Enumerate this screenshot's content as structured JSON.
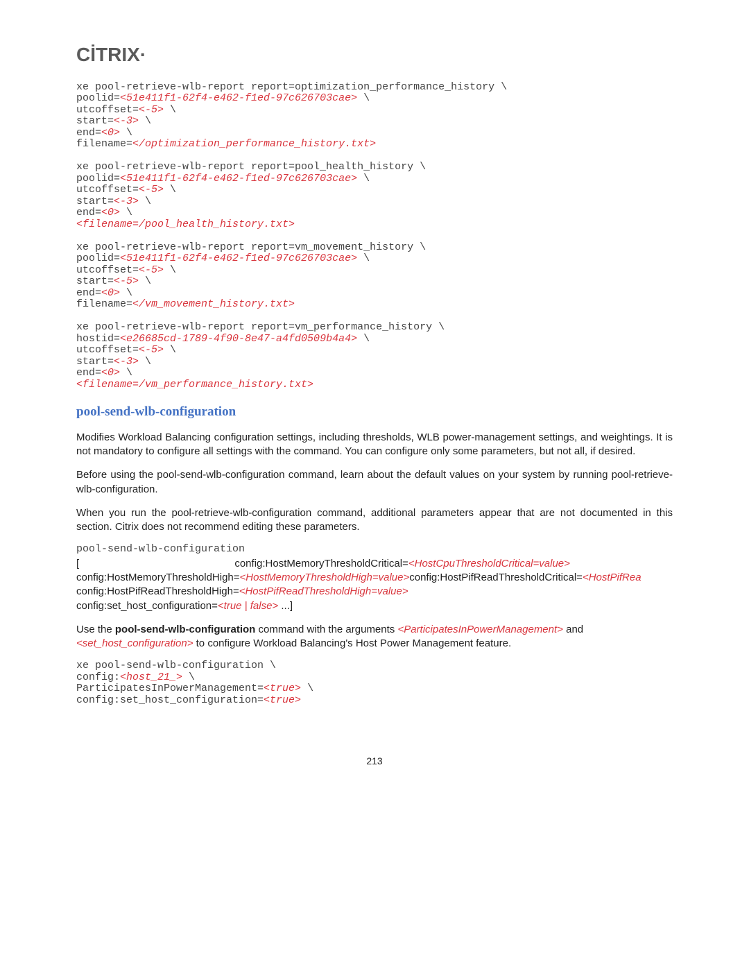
{
  "logo": "CİTRIX",
  "logo_mark": "·",
  "code1": {
    "l1a": "xe pool-retrieve-wlb-report report=optimization_performance_history \\",
    "l2a": "poolid=",
    "l2b": "<51e411f1-62f4-e462-f1ed-97c626703cae>",
    "l2c": " \\",
    "l3a": "utcoffset=",
    "l3b": "<-5>",
    "l3c": " \\",
    "l4a": "start=",
    "l4b": "<-3>",
    "l4c": " \\",
    "l5a": "end=",
    "l5b": "<0>",
    "l5c": " \\",
    "l6a": "filename=",
    "l6b": "</optimization_performance_history.txt>",
    "blank1": " ",
    "l7a": "xe pool-retrieve-wlb-report report=pool_health_history \\",
    "l8a": "poolid=",
    "l8b": "<51e411f1-62f4-e462-f1ed-97c626703cae>",
    "l8c": " \\",
    "l9a": "utcoffset=",
    "l9b": "<-5>",
    "l9c": " \\",
    "l10a": "start=",
    "l10b": "<-3>",
    "l10c": " \\",
    "l11a": "end=",
    "l11b": "<0>",
    "l11c": " \\",
    "l12b": "<filename=/pool_health_history.txt>",
    "blank2": " ",
    "l13a": "xe pool-retrieve-wlb-report report=vm_movement_history \\",
    "l14a": "poolid=",
    "l14b": "<51e411f1-62f4-e462-f1ed-97c626703cae>",
    "l14c": " \\",
    "l15a": "utcoffset=",
    "l15b": "<-5>",
    "l15c": " \\",
    "l16a": "start=",
    "l16b": "<-5>",
    "l16c": " \\",
    "l17a": "end=",
    "l17b": "<0>",
    "l17c": " \\",
    "l18a": "filename=",
    "l18b": "</vm_movement_history.txt>",
    "blank3": " ",
    "l19a": "xe pool-retrieve-wlb-report report=vm_performance_history \\",
    "l20a": "hostid=",
    "l20b": "<e26685cd-1789-4f90-8e47-a4fd0509b4a4>",
    "l20c": " \\",
    "l21a": "utcoffset=",
    "l21b": "<-5>",
    "l21c": " \\",
    "l22a": "start=",
    "l22b": "<-3>",
    "l22c": " \\",
    "l23a": "end=",
    "l23b": "<0>",
    "l23c": " \\",
    "l24b": "<filename=/vm_performance_history.txt>"
  },
  "heading1": "pool-send-wlb-configuration",
  "para1": "Modifies Workload Balancing configuration settings, including thresholds, WLB power-management settings, and weightings. It is not mandatory to configure all settings with the command. You can configure only some parameters, but not all, if desired.",
  "para2": "Before using the pool-send-wlb-configuration command, learn about the default values on your system by running pool-retrieve-wlb-configuration.",
  "para3": "When you run the pool-retrieve-wlb-configuration command, additional parameters appear that are not documented in this section. Citrix does not recommend editing these parameters.",
  "code2": {
    "l1": "pool-send-wlb-configuration"
  },
  "mix1": {
    "a": "[ ",
    "sp": "                         ",
    "b": "config:HostMemoryThresholdCritical=",
    "c": "<HostCpuThresholdCritical=value>",
    "d": " config:HostMemoryThresholdHigh=",
    "e": "<HostMemoryThresholdHigh=value>",
    "f": "config:HostPifReadThresholdCritical=",
    "g": "<HostPifRea",
    "h": " config:HostPifReadThresholdHigh=",
    "i": "<HostPifReadThresholdHigh=value>",
    "j": " config:set_host_configuration=",
    "k": "<true | false>",
    "l": " ...]"
  },
  "para4": {
    "a": "Use the ",
    "b": "pool-send-wlb-configuration",
    "c": " command with the arguments ",
    "d": "<ParticipatesInPowerManagement>",
    "e": " and ",
    "f": "<set_host_configuration>",
    "g": " to configure Workload Balancing's Host Power Management feature."
  },
  "code3": {
    "l1": "xe pool-send-wlb-configuration \\",
    "l2a": "config:",
    "l2b": "<host_21_>",
    "l2c": " \\",
    "l3a": "ParticipatesInPowerManagement=",
    "l3b": "<true>",
    "l3c": " \\",
    "l4a": "config:set_host_configuration=",
    "l4b": "<true>"
  },
  "pagenum": "213"
}
